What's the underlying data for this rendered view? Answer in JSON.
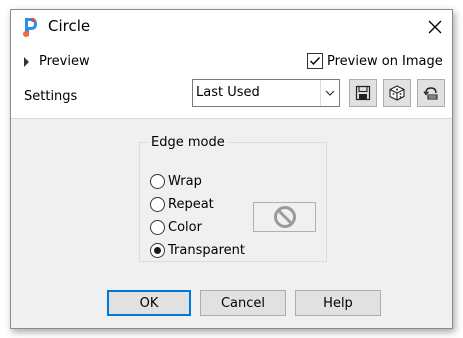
{
  "window": {
    "title": "Circle",
    "app_icon": "paintshop-pro-icon",
    "close_icon": "close-icon"
  },
  "top": {
    "preview_label": "Preview",
    "preview_on_image_label": "Preview on Image",
    "preview_on_image_checked": true,
    "settings_label": "Settings",
    "settings_value": "Last Used"
  },
  "toolbar_icons": [
    "save-preset-icon",
    "randomize-icon",
    "reset-icon"
  ],
  "edge_mode": {
    "label": "Edge mode",
    "options": [
      {
        "label": "Wrap",
        "checked": false
      },
      {
        "label": "Repeat",
        "checked": false
      },
      {
        "label": "Color",
        "checked": false
      },
      {
        "label": "Transparent",
        "checked": true
      }
    ],
    "color_swatch_icon": "no-color-icon"
  },
  "buttons": {
    "ok": "OK",
    "cancel": "Cancel",
    "help": "Help"
  },
  "colors": {
    "dialog_bg": "#f0f0f0",
    "accent": "#0078d7",
    "button_bg": "#e1e1e1"
  }
}
